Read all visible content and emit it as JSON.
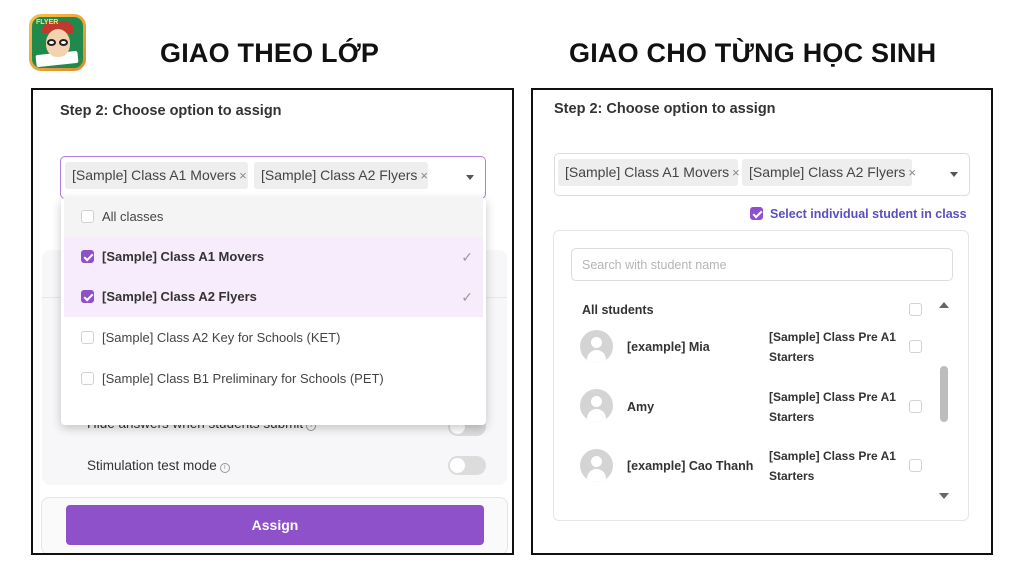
{
  "headings": {
    "left": "GIAO THEO LỚP",
    "right": "GIAO CHO TỪNG HỌC SINH"
  },
  "logo": {
    "icon": "flyer-mascot-logo-icon",
    "text": "FLYER"
  },
  "left_panel": {
    "step_title": "Step 2: Choose option to assign",
    "selected_chips": [
      {
        "label": "[Sample] Class A1 Movers",
        "remove": "×"
      },
      {
        "label": "[Sample] Class A2 Flyers",
        "remove": "×"
      }
    ],
    "dropdown": {
      "options": [
        {
          "label": "All classes",
          "checked": false
        },
        {
          "label": "[Sample] Class A1 Movers",
          "checked": true,
          "check_mark": "✓"
        },
        {
          "label": "[Sample] Class A2 Flyers",
          "checked": true,
          "check_mark": "✓"
        },
        {
          "label": "[Sample] Class A2 Key for Schools (KET)",
          "checked": false
        },
        {
          "label": "[Sample] Class B1 Preliminary for Schools (PET)",
          "checked": false
        }
      ]
    },
    "settings": [
      {
        "label": "Hide answers when students submit",
        "enabled": false
      },
      {
        "label": "Stimulation test mode",
        "enabled": false
      }
    ],
    "info_glyph": "i",
    "assign_button": "Assign"
  },
  "right_panel": {
    "step_title": "Step 2: Choose option to assign",
    "selected_chips": [
      {
        "label": "[Sample] Class A1 Movers",
        "remove": "×"
      },
      {
        "label": "[Sample] Class A2 Flyers",
        "remove": "×"
      }
    ],
    "individual_toggle": {
      "label": "Select individual student in class",
      "checked": true
    },
    "search": {
      "placeholder": "Search with student name",
      "value": ""
    },
    "all_students_label": "All students",
    "students": [
      {
        "name": "[example] Mia",
        "class": "[Sample] Class Pre A1 Starters",
        "checked": false
      },
      {
        "name": "Amy",
        "class": "[Sample] Class Pre A1 Starters",
        "checked": false
      },
      {
        "name": "[example] Cao Thanh",
        "class": "[Sample] Class Pre A1 Starters",
        "checked": false
      }
    ]
  },
  "colors": {
    "accent": "#8e51c9",
    "selected_row_bg": "#f7ecfb",
    "link_text": "#5a4fbf",
    "panel_border": "#111111"
  }
}
